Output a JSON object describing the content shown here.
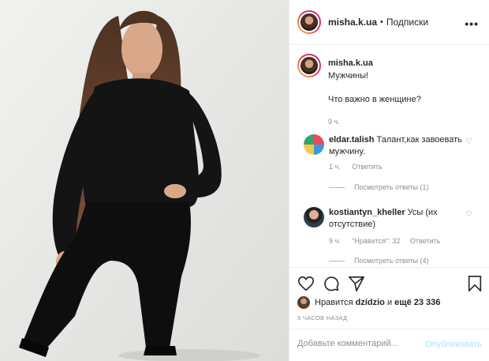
{
  "header": {
    "username": "misha.k.ua",
    "separator": "•",
    "follow_label": "Подписки",
    "more_label": "•••"
  },
  "caption": {
    "username": "misha.k.ua",
    "line1": "Мужчины!",
    "line2": "Что важно в женщине?",
    "time": "9 ч."
  },
  "comments": [
    {
      "username": "eldar.talish",
      "text": "Талант,как завоевать мужчину.",
      "time": "1 ч.",
      "reply_label": "Ответить",
      "view_replies": "Посмотреть ответы (1)"
    },
    {
      "username": "kostiantyn_kheller",
      "text": "Усы (их отсутствие)",
      "time": "9 ч.",
      "likes": "\"Нравится\": 32",
      "reply_label": "Ответить",
      "view_replies": "Посмотреть ответы (4)"
    }
  ],
  "likes": {
    "prefix": "Нравится",
    "user": "dzidzio",
    "connector": "и",
    "rest": "ещё 23 336"
  },
  "timestamp": "9 ЧАСОВ НАЗАД",
  "add_comment": {
    "placeholder": "Добавьте комментарий...",
    "publish_label": "Опубликовать"
  },
  "icons": [
    "heart-icon",
    "comment-icon",
    "share-icon",
    "bookmark-icon",
    "more-icon"
  ],
  "colors": {
    "publish_disabled": "#b2dffc",
    "muted": "#8e8e8e",
    "text": "#262626"
  }
}
